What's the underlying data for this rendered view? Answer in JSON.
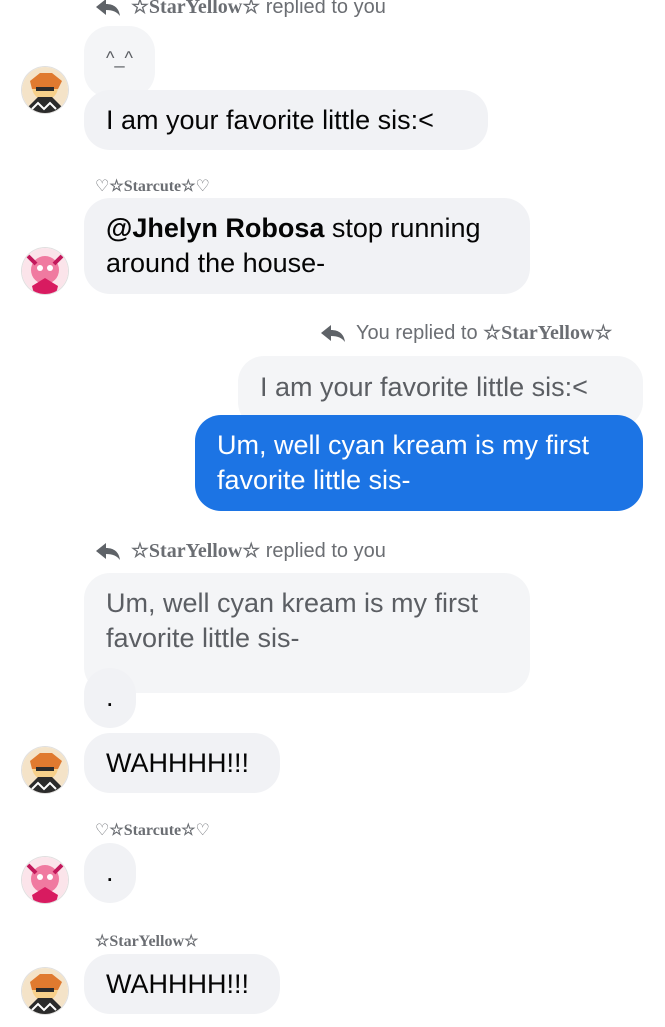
{
  "messages": {
    "m1": {
      "reply_name": "☆StarYellow☆",
      "reply_suffix": "replied to you",
      "quote": "^_^",
      "text": "I am your favorite little sis:<"
    },
    "m2": {
      "sender": "♡☆Starcute☆♡",
      "mention": "@Jhelyn Robosa",
      "text": " stop running around the house-"
    },
    "m3": {
      "reply_prefix": "You replied to",
      "reply_name": "☆StarYellow☆",
      "quote": "I am your favorite little sis:<",
      "text": "Um, well cyan kream is my first favorite little sis-"
    },
    "m4": {
      "reply_name": "☆StarYellow☆",
      "reply_suffix": "replied to you",
      "quote": "Um, well cyan kream is my first favorite little sis-",
      "dot": ".",
      "text": "WAHHHH!!!"
    },
    "m5": {
      "sender": "♡☆Starcute☆♡",
      "text": "."
    },
    "m6": {
      "sender": "☆StarYellow☆",
      "text": "WAHHHH!!!"
    }
  },
  "colors": {
    "bubble_other": "#f1f2f5",
    "bubble_mine": "#1c74e4",
    "meta_text": "#6b6e73"
  }
}
